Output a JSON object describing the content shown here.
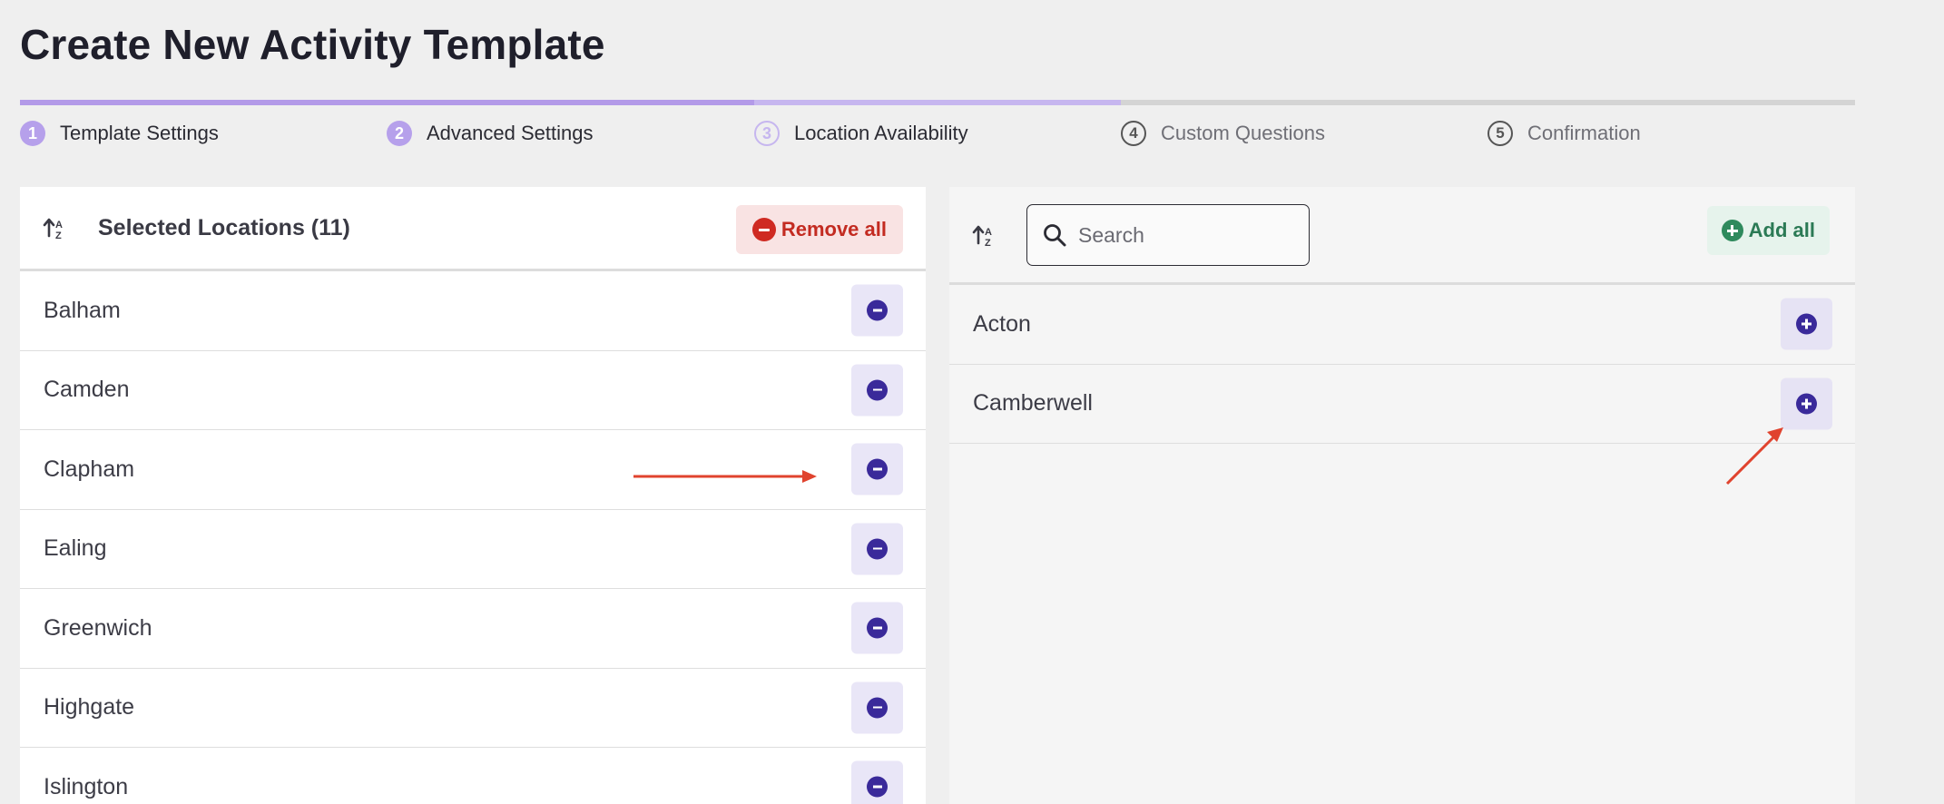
{
  "page": {
    "title": "Create New Activity Template"
  },
  "stepper": {
    "steps": [
      {
        "number": "1",
        "label": "Template Settings",
        "state": "done"
      },
      {
        "number": "2",
        "label": "Advanced Settings",
        "state": "done"
      },
      {
        "number": "3",
        "label": "Location Availability",
        "state": "current"
      },
      {
        "number": "4",
        "label": "Custom Questions",
        "state": "todo"
      },
      {
        "number": "5",
        "label": "Confirmation",
        "state": "todo"
      }
    ]
  },
  "selected_panel": {
    "title": "Selected Locations (11)",
    "remove_all_label": "Remove all",
    "items": [
      "Balham",
      "Camden",
      "Clapham",
      "Ealing",
      "Greenwich",
      "Highgate",
      "Islington"
    ]
  },
  "available_panel": {
    "search_placeholder": "Search",
    "add_all_label": "Add all",
    "items": [
      "Acton",
      "Camberwell"
    ]
  },
  "colors": {
    "accent": "#3a2a9a",
    "remove": "#cf2a22",
    "add": "#2f8a5d",
    "annotation": "#e0432e"
  }
}
